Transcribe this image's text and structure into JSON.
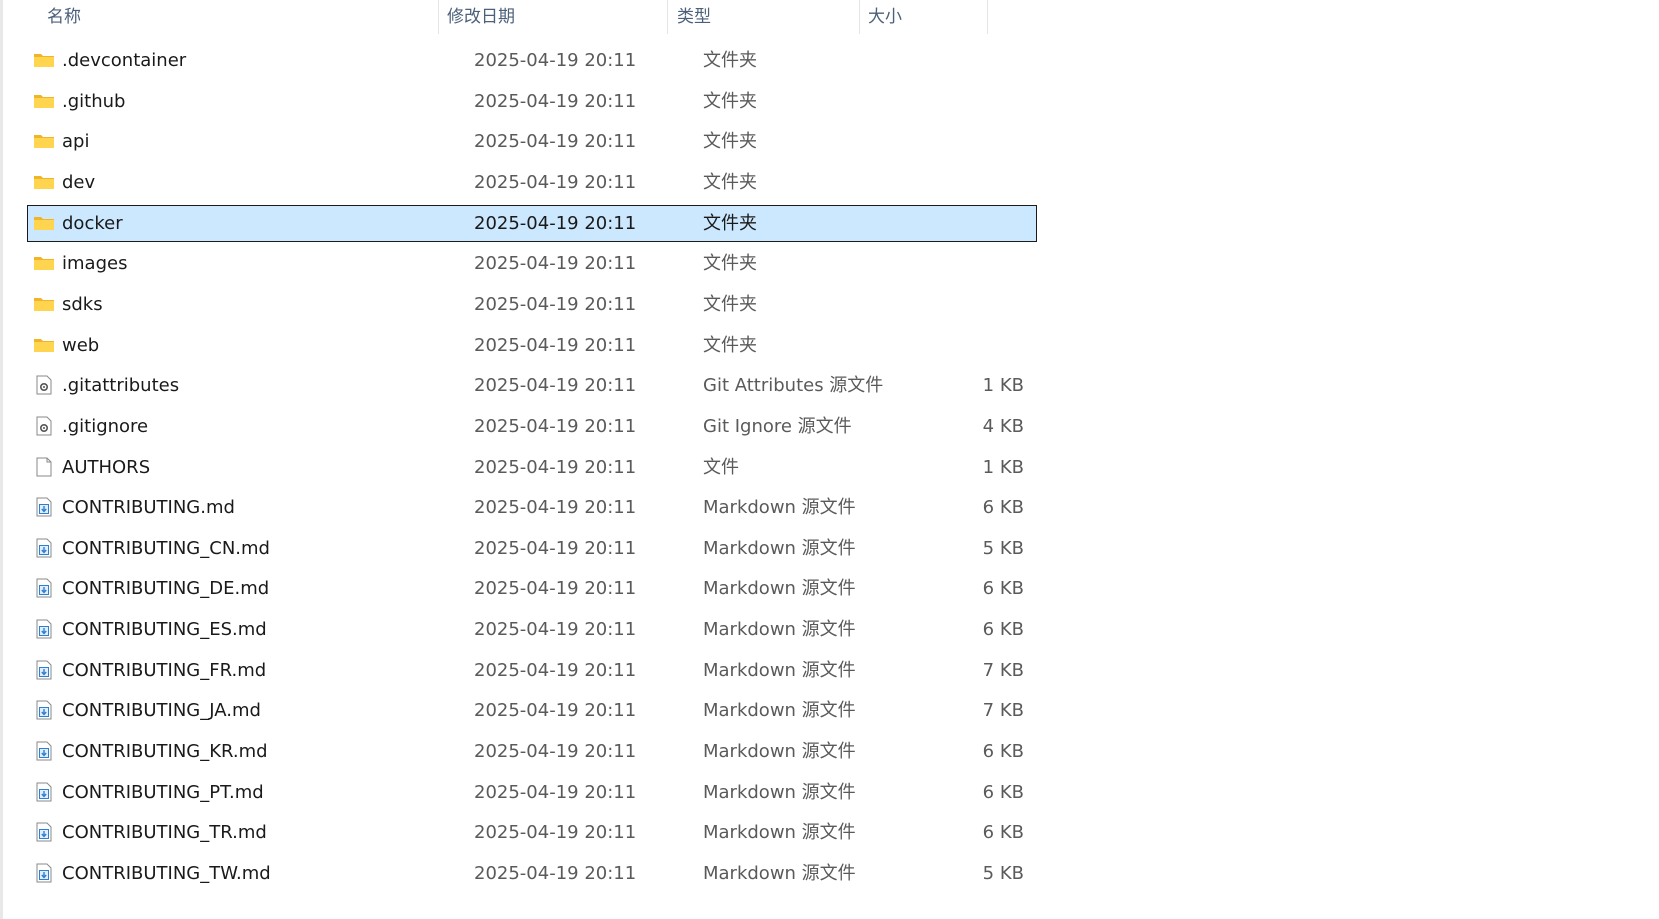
{
  "columns": {
    "name": "名称",
    "modified": "修改日期",
    "type": "类型",
    "size": "大小"
  },
  "sort_indicator": "^",
  "files": [
    {
      "name": ".devcontainer",
      "modified": "2025-04-19 20:11",
      "type": "文件夹",
      "size": "",
      "icon": "folder-icon"
    },
    {
      "name": ".github",
      "modified": "2025-04-19 20:11",
      "type": "文件夹",
      "size": "",
      "icon": "folder-icon"
    },
    {
      "name": "api",
      "modified": "2025-04-19 20:11",
      "type": "文件夹",
      "size": "",
      "icon": "folder-icon"
    },
    {
      "name": "dev",
      "modified": "2025-04-19 20:11",
      "type": "文件夹",
      "size": "",
      "icon": "folder-icon"
    },
    {
      "name": "docker",
      "modified": "2025-04-19 20:11",
      "type": "文件夹",
      "size": "",
      "icon": "folder-icon",
      "selected": true
    },
    {
      "name": "images",
      "modified": "2025-04-19 20:11",
      "type": "文件夹",
      "size": "",
      "icon": "folder-icon"
    },
    {
      "name": "sdks",
      "modified": "2025-04-19 20:11",
      "type": "文件夹",
      "size": "",
      "icon": "folder-icon"
    },
    {
      "name": "web",
      "modified": "2025-04-19 20:11",
      "type": "文件夹",
      "size": "",
      "icon": "folder-icon"
    },
    {
      "name": ".gitattributes",
      "modified": "2025-04-19 20:11",
      "type": "Git Attributes 源文件",
      "size": "1 KB",
      "icon": "settings-file-icon"
    },
    {
      "name": ".gitignore",
      "modified": "2025-04-19 20:11",
      "type": "Git Ignore 源文件",
      "size": "4 KB",
      "icon": "settings-file-icon"
    },
    {
      "name": "AUTHORS",
      "modified": "2025-04-19 20:11",
      "type": "文件",
      "size": "1 KB",
      "icon": "blank-file-icon"
    },
    {
      "name": "CONTRIBUTING.md",
      "modified": "2025-04-19 20:11",
      "type": "Markdown 源文件",
      "size": "6 KB",
      "icon": "markdown-file-icon"
    },
    {
      "name": "CONTRIBUTING_CN.md",
      "modified": "2025-04-19 20:11",
      "type": "Markdown 源文件",
      "size": "5 KB",
      "icon": "markdown-file-icon"
    },
    {
      "name": "CONTRIBUTING_DE.md",
      "modified": "2025-04-19 20:11",
      "type": "Markdown 源文件",
      "size": "6 KB",
      "icon": "markdown-file-icon"
    },
    {
      "name": "CONTRIBUTING_ES.md",
      "modified": "2025-04-19 20:11",
      "type": "Markdown 源文件",
      "size": "6 KB",
      "icon": "markdown-file-icon"
    },
    {
      "name": "CONTRIBUTING_FR.md",
      "modified": "2025-04-19 20:11",
      "type": "Markdown 源文件",
      "size": "7 KB",
      "icon": "markdown-file-icon"
    },
    {
      "name": "CONTRIBUTING_JA.md",
      "modified": "2025-04-19 20:11",
      "type": "Markdown 源文件",
      "size": "7 KB",
      "icon": "markdown-file-icon"
    },
    {
      "name": "CONTRIBUTING_KR.md",
      "modified": "2025-04-19 20:11",
      "type": "Markdown 源文件",
      "size": "6 KB",
      "icon": "markdown-file-icon"
    },
    {
      "name": "CONTRIBUTING_PT.md",
      "modified": "2025-04-19 20:11",
      "type": "Markdown 源文件",
      "size": "6 KB",
      "icon": "markdown-file-icon"
    },
    {
      "name": "CONTRIBUTING_TR.md",
      "modified": "2025-04-19 20:11",
      "type": "Markdown 源文件",
      "size": "6 KB",
      "icon": "markdown-file-icon"
    },
    {
      "name": "CONTRIBUTING_TW.md",
      "modified": "2025-04-19 20:11",
      "type": "Markdown 源文件",
      "size": "5 KB",
      "icon": "markdown-file-icon"
    }
  ]
}
